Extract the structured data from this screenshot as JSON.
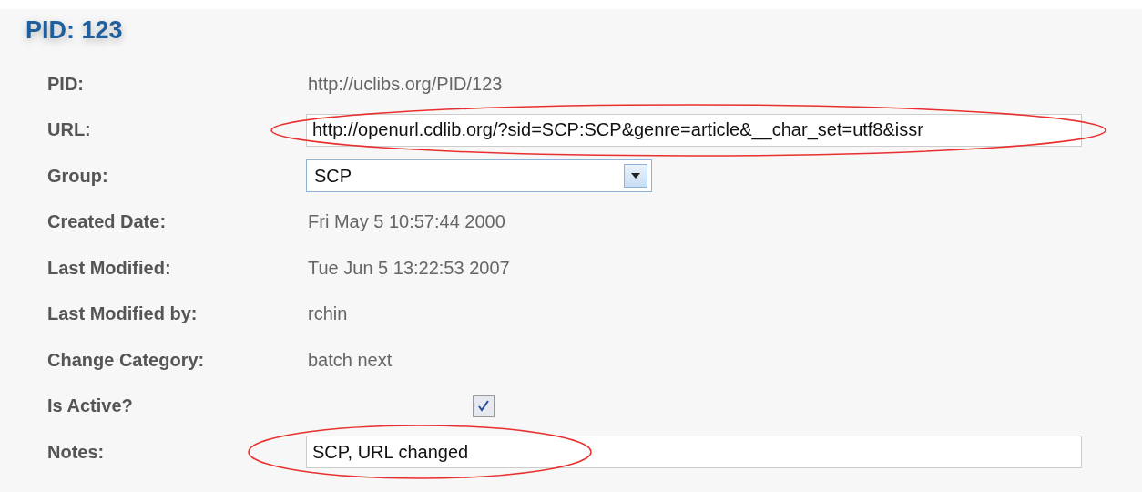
{
  "title": "PID: 123",
  "fields": [
    {
      "label": "PID:",
      "kind": "text",
      "value": "http://uclibs.org/PID/123"
    },
    {
      "label": "URL:",
      "kind": "input",
      "value": "http://openurl.cdlib.org/?sid=SCP:SCP&genre=article&__char_set=utf8&issr",
      "circled": true
    },
    {
      "label": "Group:",
      "kind": "select",
      "value": "SCP"
    },
    {
      "label": "Created Date:",
      "kind": "text",
      "value": "Fri May 5 10:57:44 2000"
    },
    {
      "label": "Last Modified:",
      "kind": "text",
      "value": "Tue Jun 5 13:22:53 2007"
    },
    {
      "label": "Last Modified by:",
      "kind": "text",
      "value": "rchin"
    },
    {
      "label": "Change Category:",
      "kind": "text",
      "value": "batch next"
    },
    {
      "label": "Is Active?",
      "kind": "checkbox",
      "checked": true
    },
    {
      "label": "Notes:",
      "kind": "input",
      "value": "SCP, URL changed",
      "circled": true
    }
  ]
}
